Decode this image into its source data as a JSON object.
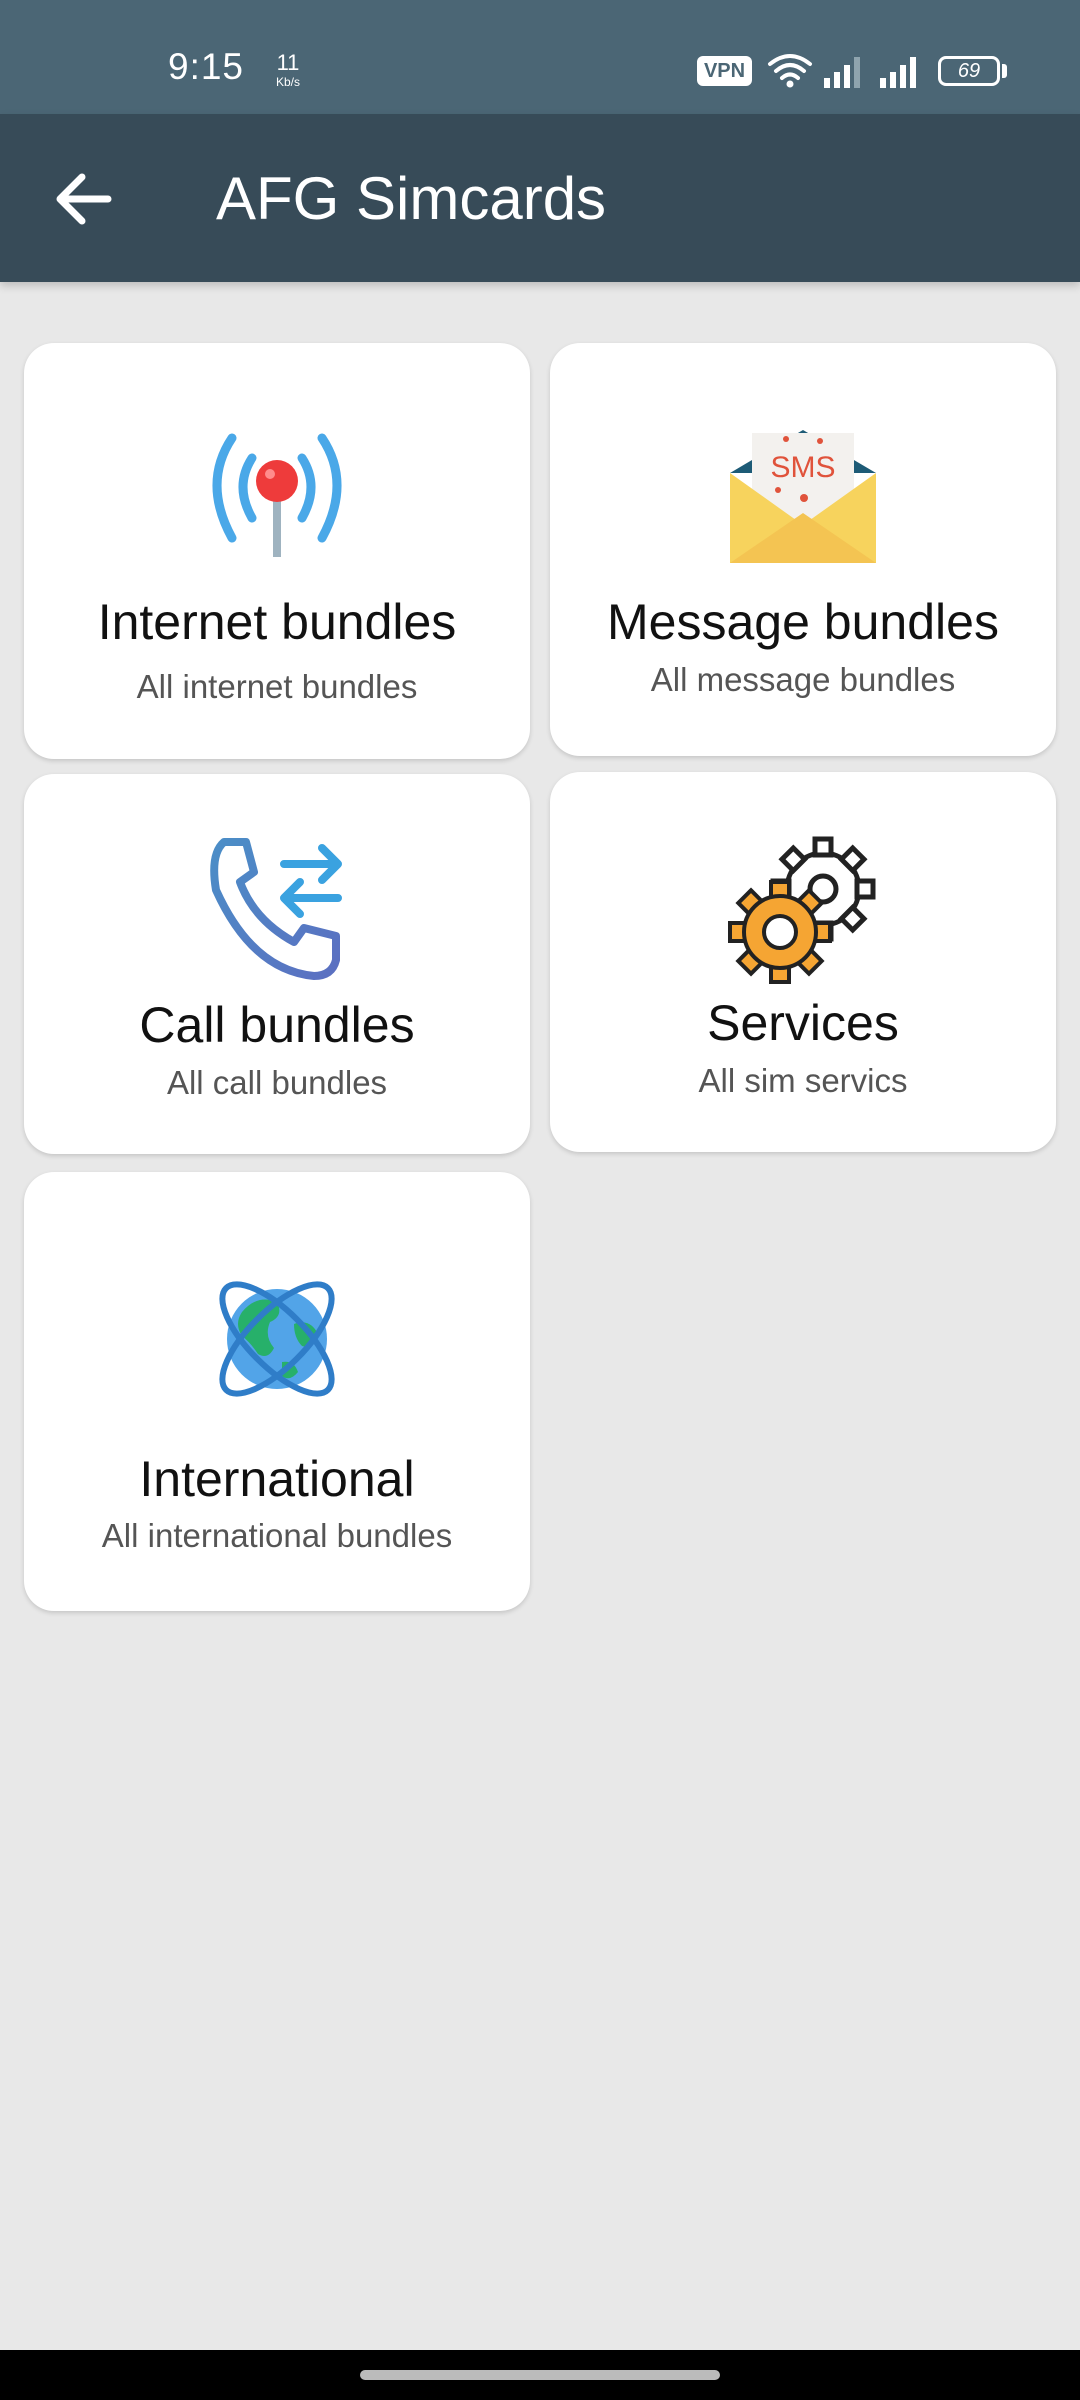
{
  "status_bar": {
    "time": "9:15",
    "net_speed_value": "11",
    "net_speed_unit": "Kb/s",
    "vpn_label": "VPN",
    "battery_level": "69"
  },
  "app_bar": {
    "title": "AFG Simcards",
    "back_icon": "arrow-left-icon"
  },
  "cards": [
    {
      "title": "Internet bundles",
      "subtitle": "All internet bundles",
      "icon": "antenna-icon"
    },
    {
      "title": "Message bundles",
      "subtitle": "All message bundles",
      "icon": "sms-envelope-icon"
    },
    {
      "title": "Call bundles",
      "subtitle": "All call bundles",
      "icon": "phone-arrows-icon"
    },
    {
      "title": "Services",
      "subtitle": "All sim servics",
      "icon": "gears-icon"
    },
    {
      "title": "International",
      "subtitle": "All international bundles",
      "icon": "globe-icon"
    }
  ],
  "colors": {
    "status_bar": "#4b6675",
    "app_bar": "#374b58",
    "background": "#e8e8e8",
    "card": "#ffffff"
  }
}
